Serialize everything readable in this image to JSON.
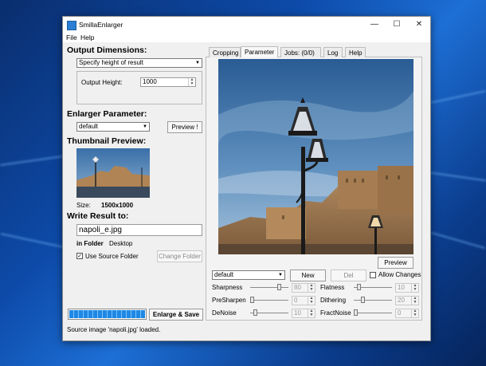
{
  "window": {
    "title": "SmillaEnlarger"
  },
  "menu": [
    "File",
    "Help"
  ],
  "output_dimensions": {
    "heading": "Output Dimensions:",
    "mode": "Specify height of result",
    "height_label": "Output Height:",
    "height_value": "1000"
  },
  "enlarger": {
    "heading": "Enlarger Parameter:",
    "preset": "default",
    "preview_label": "Preview !"
  },
  "thumbnail": {
    "heading": "Thumbnail Preview:",
    "size_label": "Size:",
    "size_value": "1500x1000"
  },
  "write_result": {
    "heading": "Write Result to:",
    "filename": "napoli_e.jpg",
    "in_folder_label": "in Folder",
    "folder": "Desktop",
    "use_source_label": "Use Source Folder",
    "use_source_checked": true,
    "change_folder_label": "Change Folder"
  },
  "progress": {
    "fraction": 1.0
  },
  "enlarge_save_label": "Enlarge & Save",
  "status": "Source image 'napoli.jpg' loaded.",
  "tabs": [
    "Cropping",
    "Parameter",
    "Jobs: (0/0)",
    "Log",
    "Help"
  ],
  "active_tab": 1,
  "preview_button": "Preview",
  "params": {
    "preset": "default",
    "new_label": "New",
    "del_label": "Del",
    "allow_changes_label": "Allow Changes",
    "left": [
      {
        "label": "Sharpness",
        "value": "80",
        "level": 0.8
      },
      {
        "label": "PreSharpen",
        "value": "0",
        "level": 0.0
      },
      {
        "label": "DeNoise",
        "value": "10",
        "level": 0.1
      }
    ],
    "right": [
      {
        "label": "Flatness",
        "value": "10",
        "level": 0.1
      },
      {
        "label": "Dithering",
        "value": "20",
        "level": 0.2
      },
      {
        "label": "FractNoise",
        "value": "0",
        "level": 0.0
      }
    ]
  }
}
